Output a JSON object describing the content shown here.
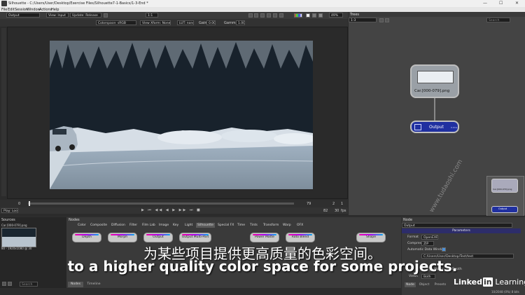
{
  "window": {
    "title": "Silhouette - C:/Users/User/Desktop/Exercise Files/Silhouette7-1-Basics/1-3-End *",
    "minimize": "—",
    "maximize": "☐",
    "close": "✕"
  },
  "menu": [
    "File",
    "Edit",
    "Session",
    "Window",
    "Actions",
    "Help"
  ],
  "toolbar": {
    "view_node": "Output",
    "view_input": "View: Input",
    "update": "Update: Release",
    "zoom_ratio": "1:1",
    "zoom_percent": "49%"
  },
  "viewer_controls": {
    "colorspace": "Colorspace: sRGB",
    "view_xform": "View Xform: None",
    "lut": "LUT: none",
    "gain_label": "Gain",
    "gain_value": "0.00",
    "gamma_label": "Gamma",
    "gamma_value": "1.00"
  },
  "timeline": {
    "start": "0",
    "current": "79",
    "in": "2",
    "out": "1",
    "end_frame": "82",
    "fps": "30",
    "fps_unit": "fps",
    "play_mode": "Play: Loop"
  },
  "trees": {
    "title": "Trees",
    "tree_select": "1-3",
    "search_placeholder": "Search",
    "node_car": "Car.[000-079].png",
    "node_output": "Output",
    "node_output_badge": "0.0ms",
    "mini_car": "Car.[000-079].png",
    "mini_output": "Output"
  },
  "sources": {
    "title": "Sources",
    "item_name": "Car.[000-079].png",
    "item_info": "80 - 1920x1080 @ 30",
    "search_placeholder": "Search"
  },
  "nodes": {
    "title": "Nodes",
    "categories": [
      "Color",
      "Composite",
      "Diffusion",
      "Filter",
      "Film Lab",
      "Image",
      "Key",
      "Light",
      "Silhouette",
      "Special FX",
      "Time",
      "Tints",
      "Transform",
      "Warp",
      "OFX"
    ],
    "active_category": "Silhouette",
    "buttons": [
      "Depth",
      "Morph",
      "Output",
      "Output Multi-Part",
      "Power Matte",
      "Roto Blend",
      "Shape"
    ],
    "bottom_tabs": [
      "Nodes",
      "Timeline"
    ],
    "search_placeholder": "Search"
  },
  "node_panel": {
    "title": "Node",
    "node_name": "Output",
    "parameters": "Parameters",
    "format_label": "Format",
    "format_value": "OpenEXR",
    "compression_label": "Compression",
    "compression_value": "ZIP",
    "auto_window_label": "Automatic Data Window",
    "path": "C:/Users/User/Desktop/Test/test",
    "alpha_label": "Alpha",
    "depth_label": "Depth",
    "views_label": "Views",
    "views_value": "Both",
    "tabs": [
      "Node",
      "Object",
      "Presets"
    ],
    "status": "10/2048 (0%) 8 bits"
  },
  "subtitles": {
    "zh": "为某些项目提供更高质量的色彩空间。",
    "en": "to a higher quality color space for some projects."
  },
  "watermark": {
    "linkedin": "Linked",
    "linkedin_in": "in",
    "learning": "Learning",
    "site": "www.tudaoshi.com"
  }
}
